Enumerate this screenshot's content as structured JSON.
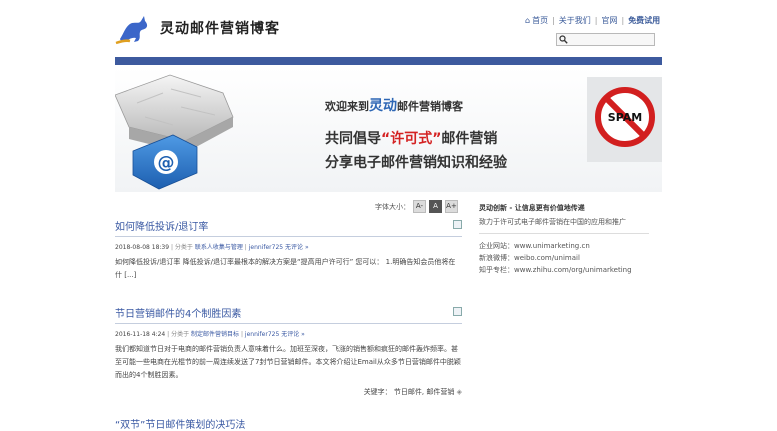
{
  "header": {
    "site_title": "灵动邮件营销博客",
    "nav": {
      "home": "首页",
      "about": "关于我们",
      "official_site": "官网",
      "free_trial": "免费试用",
      "separator": "|"
    },
    "search": {
      "placeholder": "",
      "value": ""
    }
  },
  "banner": {
    "welcome_prefix": "欢迎来到",
    "welcome_brand": "灵动",
    "welcome_suffix": "邮件营销博客",
    "line2_prefix": "共同倡导",
    "line2_highlight": "“许可式”",
    "line2_suffix": "邮件营销",
    "line3": "分享电子邮件营销知识和经验",
    "spam_label": "SPAM",
    "at_symbol": "@"
  },
  "font_size": {
    "label": "字体大小：",
    "buttons": [
      "A-",
      "A",
      "A+"
    ]
  },
  "posts": [
    {
      "title": "如何降低投诉/退订率",
      "date": "2018-08-08 18:39",
      "category_prefix": "| 分类于",
      "category": "联系人收集与管理",
      "author_sep": "|",
      "author": "jennifer725",
      "comments": "无评论 »",
      "excerpt": "如何降低投诉/退订率 降低投诉/退订率最根本的解决方案是“提高用户许可行” 您可以： 1.明确告知会员他将在什 [...]"
    },
    {
      "title": "节日营销邮件的4个制胜因素",
      "date": "2016-11-18 4:24",
      "category_prefix": "| 分类于",
      "category": "制定邮件营销目标",
      "author_sep": "|",
      "author": "jennifer725",
      "comments": "无评论 »",
      "excerpt": "我们都知道节日对于电商的邮件营销负责人意味着什么。加班至深夜，飞涨的销售额和疯狂的邮件轰炸频率。甚至可能一些电商在光棍节的前一周连续发送了7封节日营销邮件。本文将介绍让Email从众多节日营销邮件中脱颖而出的4个制胜因素。",
      "tags_label": "关键字：",
      "tags": "节日邮件, 邮件营销"
    }
  ],
  "next_post_partial": "“双节”节日邮件策划的决巧法",
  "sidebar": {
    "heading": "灵动创新 - 让信息更有价值地传递",
    "subheading": "致力于许可式电子邮件营销在中国的应用和推广",
    "items": [
      "企业网站：www.unimarketing.cn",
      "新浪微博：weibo.com/unimail",
      "知乎专栏：www.zhihu.com/org/unimarketing"
    ]
  },
  "colors": {
    "accent_bar": "#3d5a9e",
    "link": "#3a59a3",
    "brand_blue": "#2e67b5",
    "highlight_red": "#d42222"
  },
  "icons": {
    "logo": "kangaroo-logo",
    "home": "home-icon",
    "search": "search-icon",
    "rss": "rss-icon",
    "tag": "tag-icon"
  }
}
